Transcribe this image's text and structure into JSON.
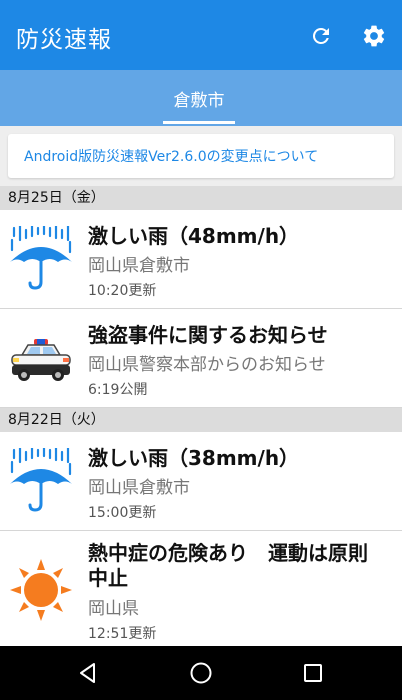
{
  "app": {
    "title": "防災速報"
  },
  "toolbar": {
    "refresh_icon": "refresh-icon",
    "settings_icon": "gear-icon"
  },
  "tabs": [
    {
      "label": "倉敷市",
      "selected": true
    }
  ],
  "notice": {
    "text": "Android版防災速報Ver2.6.0の変更点について"
  },
  "groups": [
    {
      "date": "8月25日（金）",
      "items": [
        {
          "icon": "heavy-rain-umbrella-icon",
          "title": "激しい雨（48mm/h）",
          "subtitle": "岡山県倉敷市",
          "updated": "10:20更新"
        },
        {
          "icon": "police-car-icon",
          "title": "強盗事件に関するお知らせ",
          "subtitle": "岡山県警察本部からのお知らせ",
          "updated": "6:19公開"
        }
      ]
    },
    {
      "date": "8月22日（火）",
      "items": [
        {
          "icon": "heavy-rain-umbrella-icon",
          "title": "激しい雨（38mm/h）",
          "subtitle": "岡山県倉敷市",
          "updated": "15:00更新"
        },
        {
          "icon": "sun-icon",
          "title": "熱中症の危険あり　運動は原則中止",
          "subtitle": "岡山県",
          "updated": "12:51更新"
        }
      ]
    }
  ],
  "colors": {
    "primary": "#1e88e5",
    "tab_bg": "#62a6e6",
    "accent_text": "#1e88e5",
    "sun": "#f57c1f"
  }
}
